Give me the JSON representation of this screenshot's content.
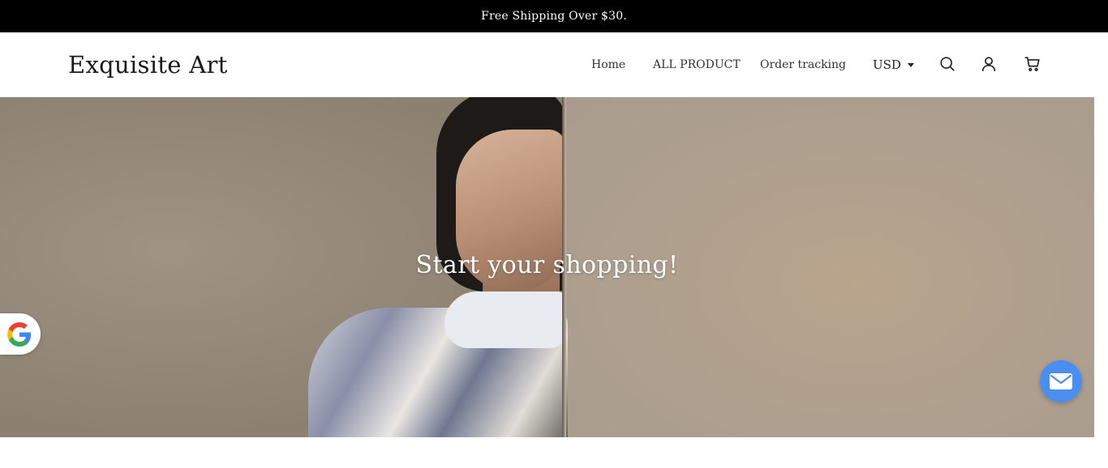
{
  "announcement": {
    "text": "Free Shipping Over $30."
  },
  "header": {
    "logo": "Exquisite Art",
    "nav": [
      {
        "label": "Home"
      },
      {
        "label": "ALL PRODUCT"
      },
      {
        "label": "Order tracking"
      }
    ],
    "currency": "USD",
    "icons": [
      "search-icon",
      "user-icon",
      "cart-icon"
    ]
  },
  "hero": {
    "title": "Start your shopping!"
  },
  "widgets": {
    "left_badge_icon": "google-icon",
    "right_button_icon": "mail-icon",
    "accent_color": "#4a8ff0"
  }
}
